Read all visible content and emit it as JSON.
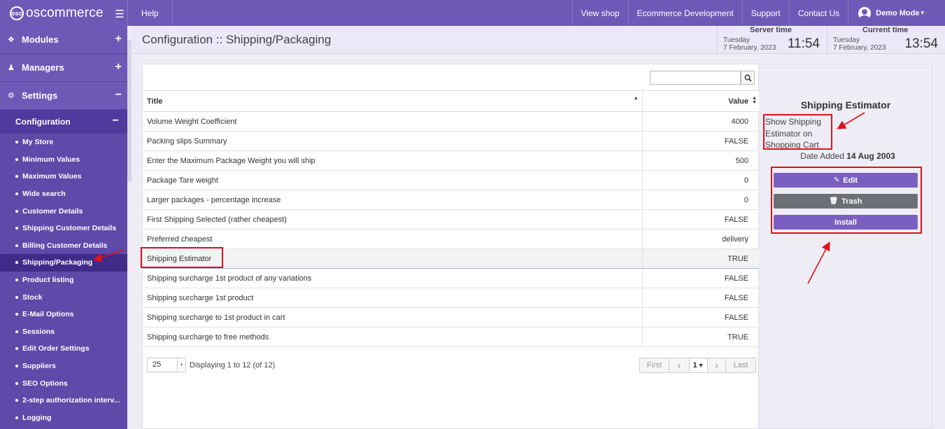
{
  "brand": {
    "logo_text": "oscommerce",
    "logo_mark": "osc",
    "menu_icon": "hamburger-icon"
  },
  "topnav": {
    "help": "Help",
    "view_shop": "View shop",
    "ecommerce_dev": "Ecommerce Development",
    "support": "Support",
    "contact_us": "Contact Us",
    "user": "Demo Mode",
    "user_caret": "▾"
  },
  "sidebar": {
    "groups": [
      {
        "label": "Modules",
        "toggle": "+"
      },
      {
        "label": "Managers",
        "toggle": "+"
      },
      {
        "label": "Settings",
        "toggle": "−"
      }
    ],
    "submenu": {
      "label": "Configuration",
      "toggle": "−"
    },
    "items": [
      "My Store",
      "Minimum Values",
      "Maximum Values",
      "Wide search",
      "Customer Details",
      "Shipping Customer Details",
      "Billing Customer Details",
      "Shipping/Packaging",
      "Product listing",
      "Stock",
      "E-Mail Options",
      "Sessions",
      "Edit Order Settings",
      "Suppliers",
      "SEO Options",
      "2-step authorization interv...",
      "Logging"
    ],
    "active_index": 7
  },
  "header": {
    "title": "Configuration :: Shipping/Packaging",
    "server_time": {
      "label": "Server time",
      "day": "Tuesday",
      "date": "7 February, 2023",
      "time": "11:54"
    },
    "current_time": {
      "label": "Current time",
      "day": "Tuesday",
      "date": "7 February, 2023",
      "time": "13:54"
    }
  },
  "search": {
    "value": "",
    "placeholder": ""
  },
  "table": {
    "columns": {
      "title": "Title",
      "value": "Value"
    },
    "rows": [
      {
        "title": "Volume Weight Coefficient",
        "value": "4000"
      },
      {
        "title": "Packing slips Summary",
        "value": "FALSE"
      },
      {
        "title": "Enter the Maximum Package Weight you will ship",
        "value": "500"
      },
      {
        "title": "Package Tare weight",
        "value": "0"
      },
      {
        "title": "Larger packages - percentage increase",
        "value": "0"
      },
      {
        "title": "First Shipping Selected (rather cheapest)",
        "value": "FALSE"
      },
      {
        "title": "Preferred cheapest",
        "value": "delivery"
      },
      {
        "title": "Shipping Estimator",
        "value": "TRUE"
      },
      {
        "title": "Shipping surcharge 1st product of any variations",
        "value": "FALSE"
      },
      {
        "title": "Shipping surcharge 1st product",
        "value": "FALSE"
      },
      {
        "title": "Shipping surcharge to 1st product in cart",
        "value": "FALSE"
      },
      {
        "title": "Shipping surcharge to free methods",
        "value": "TRUE"
      }
    ],
    "selected_index": 7
  },
  "pagination": {
    "per_page": "25",
    "displaying": "Displaying 1 to 12 (of 12)",
    "first": "First",
    "prev": "‹",
    "page": "1",
    "next": "›",
    "last": "Last"
  },
  "info": {
    "title": "Shipping Estimator",
    "description": "Show Shipping Estimator on Shopping Cart",
    "date_label": "Date Added",
    "date_value": "14 Aug 2003",
    "edit": "Edit",
    "trash": "Trash",
    "install": "Install"
  },
  "colors": {
    "brand": "#6d5ab6",
    "sidebar": "#5e4aa8",
    "button": "#7a5fc1",
    "trash": "#6d6f76",
    "annotation": "#e0111a"
  }
}
